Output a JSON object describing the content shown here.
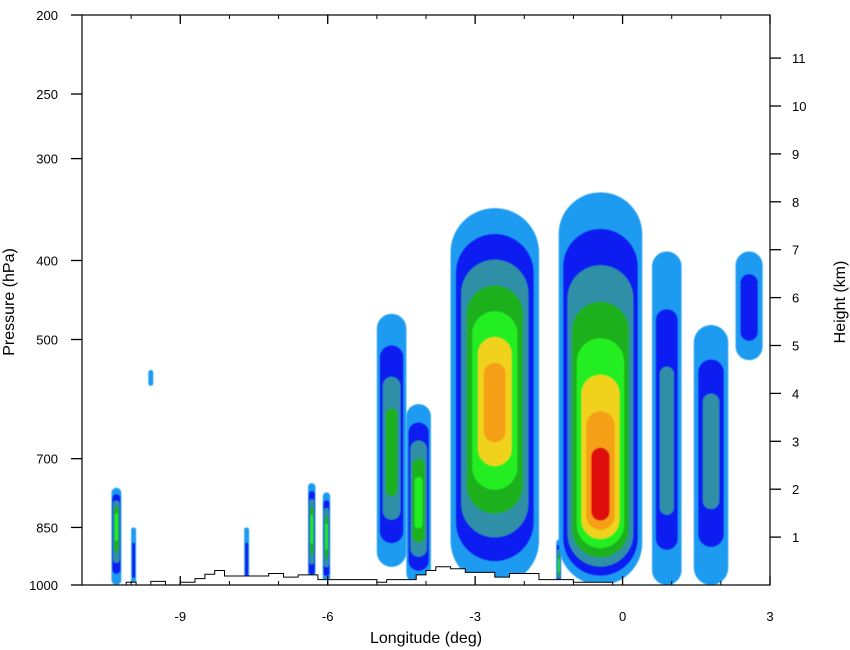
{
  "chart_data": {
    "type": "contour",
    "title": "",
    "xlabel": "Longitude (deg)",
    "ylabel_left": "Pressure (hPa)",
    "ylabel_right": "Height (km)",
    "xlim": [
      -11.0,
      3.0
    ],
    "ylim_pressure": [
      1000,
      200
    ],
    "ylim_height": [
      0,
      11.9
    ],
    "y_scale": "log",
    "grid": false,
    "legend": "none",
    "x_ticks": [
      {
        "value": -9,
        "label": "-9"
      },
      {
        "value": -6,
        "label": "-6"
      },
      {
        "value": -3,
        "label": "-3"
      },
      {
        "value": 0,
        "label": "0"
      },
      {
        "value": 3,
        "label": "3"
      }
    ],
    "pressure_ticks": [
      {
        "value": 200,
        "label": "200"
      },
      {
        "value": 250,
        "label": "250"
      },
      {
        "value": 300,
        "label": "300"
      },
      {
        "value": 400,
        "label": "400"
      },
      {
        "value": 500,
        "label": "500"
      },
      {
        "value": 700,
        "label": "700"
      },
      {
        "value": 850,
        "label": "850"
      },
      {
        "value": 1000,
        "label": "1000"
      }
    ],
    "height_ticks": [
      {
        "value": 1,
        "label": "1"
      },
      {
        "value": 2,
        "label": "2"
      },
      {
        "value": 3,
        "label": "3"
      },
      {
        "value": 4,
        "label": "4"
      },
      {
        "value": 5,
        "label": "5"
      },
      {
        "value": 6,
        "label": "6"
      },
      {
        "value": 7,
        "label": "7"
      },
      {
        "value": 8,
        "label": "8"
      },
      {
        "value": 9,
        "label": "9"
      },
      {
        "value": 10,
        "label": "10"
      },
      {
        "value": 11,
        "label": "11"
      }
    ],
    "colors": {
      "level1": "#1a9bf0",
      "level2": "#0a1cf0",
      "level3": "#2d8fa6",
      "level4": "#1fb01f",
      "level5": "#22ee22",
      "level6": "#f0d21e",
      "level7": "#f5a014",
      "level8": "#e01010"
    },
    "cells": [
      {
        "name": "cell-a",
        "x": [
          -10.4,
          -10.2
        ],
        "p": [
          1000,
          760
        ],
        "core_p": 840,
        "levels": 5
      },
      {
        "name": "cell-b",
        "x": [
          -10.0,
          -9.9
        ],
        "p": [
          1000,
          850
        ],
        "core_p": 950,
        "levels": 2
      },
      {
        "name": "cell-c",
        "x": [
          -9.65,
          -9.55
        ],
        "p": [
          570,
          545
        ],
        "core_p": 560,
        "levels": 1
      },
      {
        "name": "cell-d",
        "x": [
          -7.7,
          -7.6
        ],
        "p": [
          1000,
          850
        ],
        "core_p": 950,
        "levels": 2
      },
      {
        "name": "cell-e",
        "x": [
          -6.4,
          -6.25
        ],
        "p": [
          1000,
          750
        ],
        "core_p": 850,
        "levels": 5
      },
      {
        "name": "cell-f",
        "x": [
          -6.1,
          -5.95
        ],
        "p": [
          1000,
          770
        ],
        "core_p": 870,
        "levels": 5
      },
      {
        "name": "cell-g",
        "x": [
          -5.0,
          -4.4
        ],
        "p": [
          950,
          465
        ],
        "core_p": 700,
        "levels": 4
      },
      {
        "name": "cell-h",
        "x": [
          -4.4,
          -3.9
        ],
        "p": [
          1000,
          600
        ],
        "core_p": 800,
        "levels": 5
      },
      {
        "name": "cell-i",
        "x": [
          -3.5,
          -1.7
        ],
        "p": [
          1000,
          345
        ],
        "core_p": 600,
        "levels": 7
      },
      {
        "name": "cell-j",
        "x": [
          -1.35,
          -1.25
        ],
        "p": [
          1000,
          880
        ],
        "core_p": 950,
        "levels": 5
      },
      {
        "name": "cell-k",
        "x": [
          -1.3,
          0.4
        ],
        "p": [
          1000,
          330
        ],
        "core_p": 800,
        "levels": 8
      },
      {
        "name": "cell-l",
        "x": [
          0.6,
          1.2
        ],
        "p": [
          1000,
          390
        ],
        "core_p": 700,
        "levels": 3
      },
      {
        "name": "cell-m",
        "x": [
          1.45,
          2.15
        ],
        "p": [
          1000,
          480
        ],
        "core_p": 680,
        "levels": 3
      },
      {
        "name": "cell-n",
        "x": [
          2.3,
          2.85
        ],
        "p": [
          530,
          390
        ],
        "core_p": 460,
        "levels": 2
      }
    ],
    "terrain": [
      [
        -10.1,
        1000
      ],
      [
        -10.1,
        992
      ],
      [
        -9.9,
        992
      ],
      [
        -9.9,
        1000
      ],
      [
        -9.6,
        1000
      ],
      [
        -9.6,
        990
      ],
      [
        -9.3,
        990
      ],
      [
        -9.3,
        1000
      ],
      [
        -9.0,
        1000
      ],
      [
        -9.0,
        992
      ],
      [
        -8.7,
        992
      ],
      [
        -8.7,
        982
      ],
      [
        -8.5,
        982
      ],
      [
        -8.5,
        970
      ],
      [
        -8.3,
        970
      ],
      [
        -8.3,
        960
      ],
      [
        -8.1,
        960
      ],
      [
        -8.1,
        975
      ],
      [
        -7.2,
        975
      ],
      [
        -7.2,
        968
      ],
      [
        -6.9,
        968
      ],
      [
        -6.9,
        978
      ],
      [
        -6.6,
        978
      ],
      [
        -6.6,
        972
      ],
      [
        -6.2,
        972
      ],
      [
        -6.2,
        985
      ],
      [
        -5.0,
        985
      ],
      [
        -5.0,
        992
      ],
      [
        -4.8,
        992
      ],
      [
        -4.8,
        985
      ],
      [
        -4.2,
        985
      ],
      [
        -4.2,
        972
      ],
      [
        -4.0,
        972
      ],
      [
        -4.0,
        960
      ],
      [
        -3.8,
        960
      ],
      [
        -3.8,
        950
      ],
      [
        -3.5,
        950
      ],
      [
        -3.5,
        955
      ],
      [
        -3.2,
        955
      ],
      [
        -3.2,
        965
      ],
      [
        -2.6,
        965
      ],
      [
        -2.6,
        978
      ],
      [
        -2.3,
        978
      ],
      [
        -2.3,
        968
      ],
      [
        -1.7,
        968
      ],
      [
        -1.7,
        985
      ],
      [
        -1.0,
        985
      ],
      [
        -1.0,
        992
      ],
      [
        -0.2,
        992
      ],
      [
        -0.2,
        1000
      ]
    ]
  }
}
